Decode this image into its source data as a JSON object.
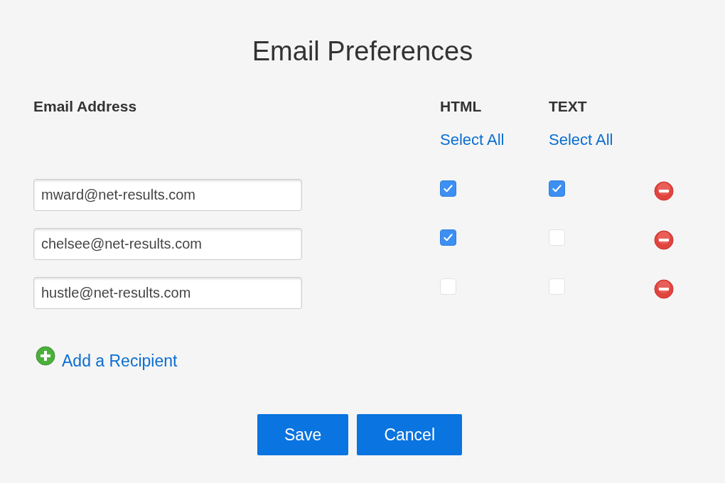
{
  "title": "Email Preferences",
  "columns": {
    "address": "Email Address",
    "html": "HTML",
    "text": "TEXT"
  },
  "select_all": {
    "html": "Select All",
    "text": "Select All"
  },
  "recipients": [
    {
      "email": "mward@net-results.com",
      "html": true,
      "text": true
    },
    {
      "email": "chelsee@net-results.com",
      "html": true,
      "text": false
    },
    {
      "email": "hustle@net-results.com",
      "html": false,
      "text": false
    }
  ],
  "add_link": "Add a Recipient",
  "buttons": [
    {
      "label": "Save"
    },
    {
      "label": "Cancel"
    }
  ]
}
